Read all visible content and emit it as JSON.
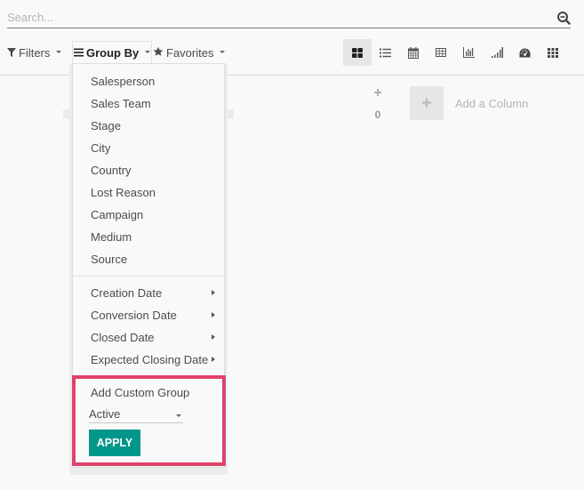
{
  "search": {
    "placeholder": "Search...",
    "value": ""
  },
  "toolbar": {
    "filters_label": "Filters",
    "groupby_label": "Group By",
    "favorites_label": "Favorites"
  },
  "views": [
    {
      "name": "kanban",
      "icon": "kanban-icon",
      "active": true
    },
    {
      "name": "list",
      "icon": "list-icon",
      "active": false
    },
    {
      "name": "calendar",
      "icon": "calendar-icon",
      "active": false
    },
    {
      "name": "pivot",
      "icon": "pivot-icon",
      "active": false
    },
    {
      "name": "graph",
      "icon": "bar-chart-icon",
      "active": false
    },
    {
      "name": "cohort",
      "icon": "cohort-icon",
      "active": false
    },
    {
      "name": "dashboard",
      "icon": "dashboard-icon",
      "active": false
    },
    {
      "name": "activity",
      "icon": "grid-icon",
      "active": false
    }
  ],
  "kanban": {
    "column_count": "0",
    "add_column_label": "Add a Column"
  },
  "groupby_menu": {
    "fields": [
      "Salesperson",
      "Sales Team",
      "Stage",
      "City",
      "Country",
      "Lost Reason",
      "Campaign",
      "Medium",
      "Source"
    ],
    "date_fields": [
      "Creation Date",
      "Conversion Date",
      "Closed Date",
      "Expected Closing Date"
    ],
    "custom_group_label": "Add Custom Group",
    "custom_group_selected": "Active",
    "apply_label": "APPLY"
  },
  "colors": {
    "highlight": "#e0436b",
    "apply_button": "#00968a"
  }
}
